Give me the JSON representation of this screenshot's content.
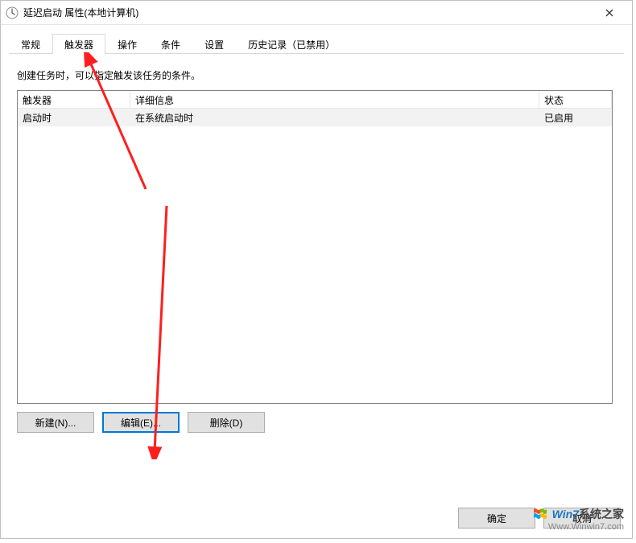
{
  "window": {
    "title": "延迟启动 属性(本地计算机)"
  },
  "tabs": {
    "items": [
      {
        "label": "常规"
      },
      {
        "label": "触发器"
      },
      {
        "label": "操作"
      },
      {
        "label": "条件"
      },
      {
        "label": "设置"
      },
      {
        "label": "历史记录（已禁用）"
      }
    ],
    "active_index": 1
  },
  "panel": {
    "description": "创建任务时，可以指定触发该任务的条件。",
    "columns": {
      "trigger": "触发器",
      "detail": "详细信息",
      "status": "状态"
    },
    "rows": [
      {
        "trigger": "启动时",
        "detail": "在系统启动时",
        "status": "已启用"
      }
    ],
    "buttons": {
      "new": "新建(N)...",
      "edit": "编辑(E)...",
      "delete": "删除(D)"
    }
  },
  "dialog_buttons": {
    "ok": "确定",
    "cancel": "取消"
  },
  "watermark": {
    "brand_a": "Win7",
    "brand_b": "系统之家",
    "url": "Www.Winwin7.com"
  }
}
